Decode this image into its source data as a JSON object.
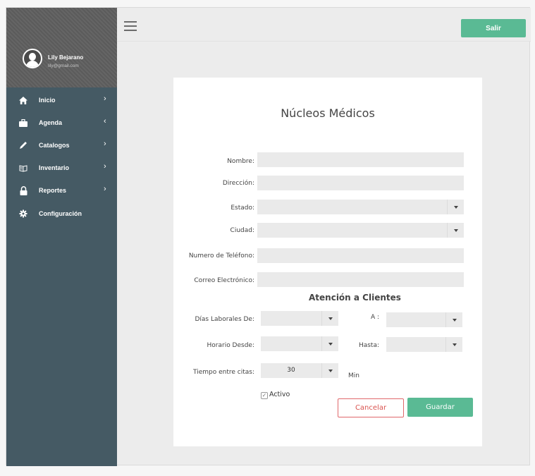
{
  "user": {
    "name": "Lily Bejarano",
    "email": "lily@gmail.com"
  },
  "sidebar": {
    "items": [
      {
        "label": "Inicio",
        "icon": "home-icon",
        "chevron": "›"
      },
      {
        "label": "Agenda",
        "icon": "briefcase-icon",
        "chevron": "‹"
      },
      {
        "label": "Catalogos",
        "icon": "pencil-icon",
        "chevron": "›"
      },
      {
        "label": "Inventario",
        "icon": "book-icon",
        "chevron": "›"
      },
      {
        "label": "Reportes",
        "icon": "lock-icon",
        "chevron": "›"
      },
      {
        "label": "Configuración",
        "icon": "gear-icon",
        "chevron": ""
      }
    ]
  },
  "header": {
    "logout_label": "Salir",
    "menu_icon": "hamburger-icon"
  },
  "form": {
    "title": "Núcleos Médicos",
    "name_label": "Nombre:",
    "address_label": "Dirección:",
    "state_label": "Estado:",
    "city_label": "Ciudad:",
    "phone_label": "Numero de Teléfono:",
    "email_label": "Correo Electrónico:",
    "section_title": "Atención a Clientes",
    "days_from_label": "Días Laborales De:",
    "days_to_label": "A :",
    "hours_from_label": "Horario Desde:",
    "hours_to_label": "Hasta:",
    "interval_label": "Tiempo entre citas:",
    "interval_value": "30",
    "interval_unit": "Min",
    "active_label": "Activo",
    "active_checked": true,
    "cancel_label": "Cancelar",
    "save_label": "Guardar"
  },
  "colors": {
    "sidebar": "#455a64",
    "accent": "#5aba94",
    "cancel": "#d9534f"
  }
}
